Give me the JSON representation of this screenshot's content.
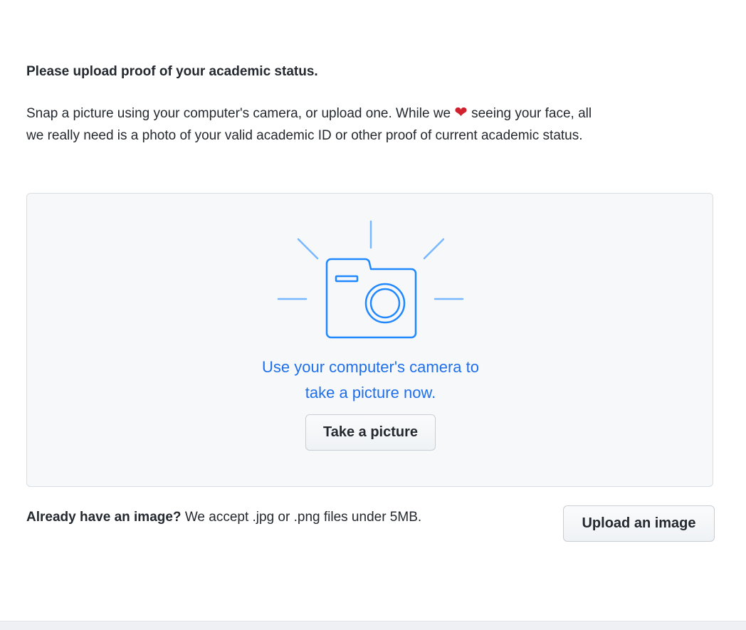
{
  "heading": "Please upload proof of your academic status.",
  "intro": {
    "before_heart": "Snap a picture using your computer's camera, or upload one. While we",
    "heart": "❤",
    "after_heart": "seeing your face, all we really need is a photo of your valid academic ID or other proof of current academic status."
  },
  "camera_panel": {
    "icon": "camera-icon",
    "line1": "Use your computer's camera to",
    "line2": "take a picture now.",
    "button_label": "Take a picture"
  },
  "upload": {
    "question": "Already have an image?",
    "note": "We accept .jpg or .png files under 5MB.",
    "button_label": "Upload an image"
  },
  "colors": {
    "accent": "#1f6feb",
    "heart": "#cf222e",
    "panel_bg": "#f6f8fa"
  }
}
